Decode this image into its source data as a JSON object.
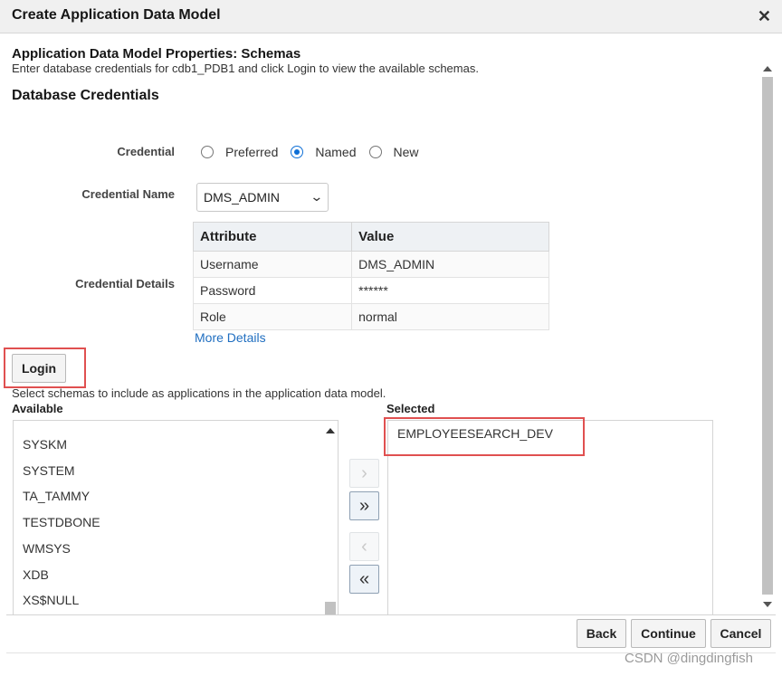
{
  "dialog": {
    "title": "Create Application Data Model"
  },
  "page": {
    "heading": "Application Data Model Properties: Schemas",
    "description": "Enter database credentials for cdb1_PDB1 and click Login to view the available schemas.",
    "section_title": "Database Credentials"
  },
  "credential": {
    "label": "Credential",
    "options": [
      "Preferred",
      "Named",
      "New"
    ],
    "selected": "Named"
  },
  "credential_name": {
    "label": "Credential Name",
    "value": "DMS_ADMIN"
  },
  "credential_details": {
    "label": "Credential Details",
    "columns": [
      "Attribute",
      "Value"
    ],
    "rows": [
      [
        "Username",
        "DMS_ADMIN"
      ],
      [
        "Password",
        "******"
      ],
      [
        "Role",
        "normal"
      ]
    ],
    "more_link": "More Details"
  },
  "login": {
    "label": "Login"
  },
  "schemas": {
    "note": "Select schemas to include as applications in the application data model.",
    "available_label": "Available",
    "selected_label": "Selected",
    "available": [
      "SYSKM",
      "SYSTEM",
      "TA_TAMMY",
      "TESTDBONE",
      "WMSYS",
      "XDB",
      "XS$NULL"
    ],
    "selected": [
      "EMPLOYEESEARCH_DEV"
    ]
  },
  "shuttle": {
    "move": "›",
    "move_all": "»",
    "remove": "‹",
    "remove_all": "«"
  },
  "footer": {
    "buttons": [
      "Back",
      "Continue",
      "Cancel"
    ],
    "watermark": "CSDN @dingdingfish"
  },
  "icons": {
    "close": "close-icon",
    "dropdown": "chevron-down-icon"
  },
  "colors": {
    "highlight": "#e05050",
    "link": "#1f6ec0",
    "radio_selected": "#0e6fd6"
  }
}
